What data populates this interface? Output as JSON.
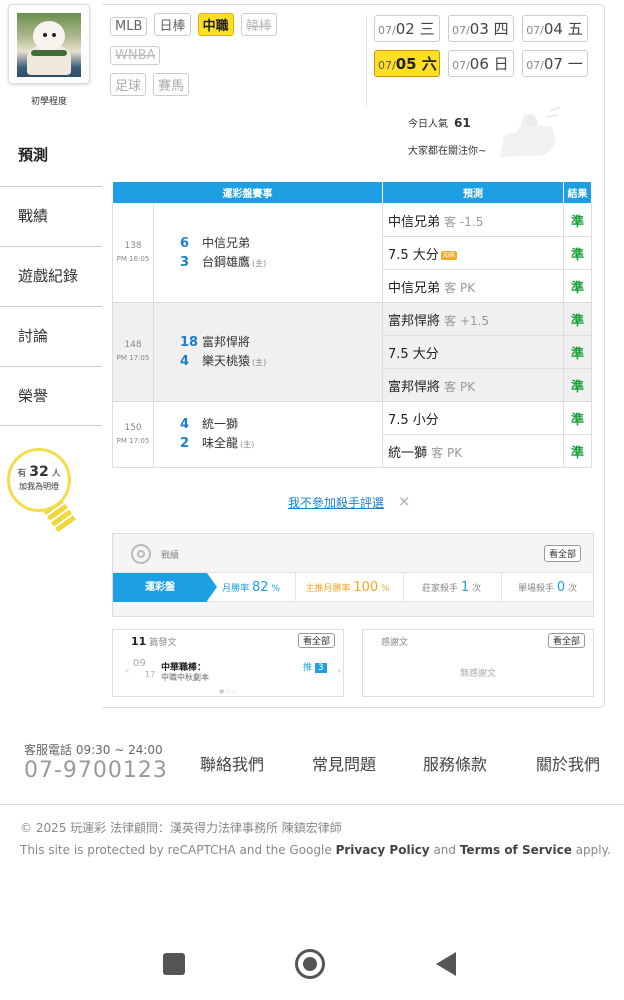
{
  "sidebar": {
    "level": "初學程度",
    "items": [
      {
        "label": "預測"
      },
      {
        "label": "戰績"
      },
      {
        "label": "遊戲紀錄"
      },
      {
        "label": "討論"
      },
      {
        "label": "榮譽"
      }
    ],
    "fans": {
      "prefix": "有",
      "count": "32",
      "suffix": "人",
      "cta": "加我為明燈"
    }
  },
  "filters": {
    "row1": [
      "MLB",
      "日棒",
      "中職",
      "韓棒"
    ],
    "row2": [
      "WNBA"
    ],
    "row3": [
      "足球",
      "賽馬"
    ],
    "active": "中職"
  },
  "dates": [
    {
      "md": "07/",
      "day": "02",
      "wd": "三"
    },
    {
      "md": "07/",
      "day": "03",
      "wd": "四"
    },
    {
      "md": "07/",
      "day": "04",
      "wd": "五"
    },
    {
      "md": "07/",
      "day": "05",
      "wd": "六"
    },
    {
      "md": "07/",
      "day": "06",
      "wd": "日"
    },
    {
      "md": "07/",
      "day": "07",
      "wd": "一"
    }
  ],
  "popularity": {
    "label": "今日人氣",
    "count": "61",
    "note": "大家都在關注你~"
  },
  "table": {
    "headers": {
      "event": "運彩盤賽事",
      "pred": "預測",
      "result": "結果"
    },
    "games": [
      {
        "no": "138",
        "time": "PM 16:05",
        "away_score": "6",
        "away": "中信兄弟",
        "home_score": "3",
        "home": "台鋼雄鷹",
        "home_tag": "(主)",
        "picks": [
          {
            "main": "中信兄弟",
            "dim": "客 -1.5",
            "result": "準"
          },
          {
            "main": "7.5 大分",
            "dim": "",
            "badge": "加碼",
            "result": "準"
          },
          {
            "main": "中信兄弟",
            "dim": "客 PK",
            "result": "準"
          }
        ]
      },
      {
        "no": "148",
        "time": "PM 17:05",
        "away_score": "18",
        "away": "富邦悍將",
        "home_score": "4",
        "home": "樂天桃猿",
        "home_tag": "(主)",
        "picks": [
          {
            "main": "富邦悍將",
            "dim": "客 +1.5",
            "result": "準"
          },
          {
            "main": "7.5 大分",
            "dim": "",
            "result": "準"
          },
          {
            "main": "富邦悍將",
            "dim": "客 PK",
            "result": "準"
          }
        ]
      },
      {
        "no": "150",
        "time": "PM 17:05",
        "away_score": "4",
        "away": "統一獅",
        "home_score": "2",
        "home": "味全龍",
        "home_tag": "(主)",
        "picks": [
          {
            "main": "7.5 小分",
            "dim": "",
            "result": "準"
          },
          {
            "main": "統一獅",
            "dim": "客 PK",
            "result": "準"
          }
        ]
      }
    ]
  },
  "optout": {
    "label": "我不參加殺手評選",
    "close": "×"
  },
  "record": {
    "title": "戰績",
    "view_all": "看全部",
    "tab": "運彩盤",
    "stats": [
      {
        "label": "月勝率",
        "value": "82",
        "unit": "%"
      },
      {
        "label": "主推月勝率",
        "value": "100",
        "unit": "%"
      },
      {
        "label": "莊家殺手",
        "value": "1",
        "unit": "次"
      },
      {
        "label": "單場殺手",
        "value": "0",
        "unit": "次"
      }
    ]
  },
  "articles": {
    "count": "11",
    "title": "篇發文",
    "view_all": "看全部",
    "item": {
      "date_top": "09",
      "date_bottom": "17",
      "title": "中華職棒：",
      "sub": "中職中秋劇本",
      "push_label": "推",
      "push_count": "3"
    }
  },
  "thanks": {
    "title": "感謝文",
    "view_all": "看全部",
    "empty": "無感謝文"
  },
  "footer": {
    "phone_label": "客服電話 09:30 ~ 24:00",
    "phone": "07-9700123",
    "links": [
      "聯絡我們",
      "常見問題",
      "服務條款",
      "關於我們"
    ],
    "copyright": "© 2025 玩運彩 法律顧問：漢英得力法律事務所 陳鎮宏律師",
    "recaptcha_pre": "This site is protected by reCAPTCHA and the Google ",
    "privacy": "Privacy Policy",
    "and": " and ",
    "terms": "Terms of Service",
    "apply": " apply."
  }
}
